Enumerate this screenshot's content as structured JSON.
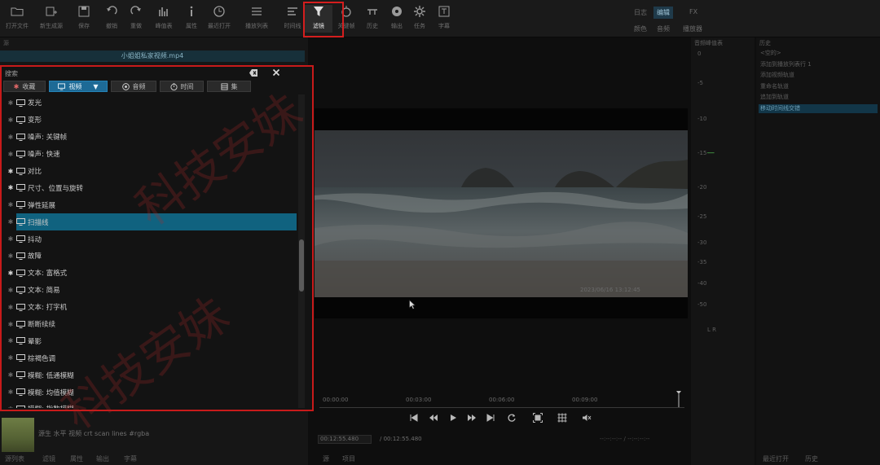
{
  "toolbar": {
    "buttons": [
      {
        "label": "打开文件",
        "icon": "folder-open-icon"
      },
      {
        "label": "新生成源",
        "icon": "new-source-icon"
      },
      {
        "label": "保存",
        "icon": "save-icon"
      },
      {
        "label": "撤销",
        "icon": "undo-icon"
      },
      {
        "label": "重做",
        "icon": "redo-icon"
      },
      {
        "label": "峰值表",
        "icon": "peak-meter-icon"
      },
      {
        "label": "属性",
        "icon": "info-icon"
      },
      {
        "label": "最近打开",
        "icon": "clock-icon"
      },
      {
        "label": "播放列表",
        "icon": "playlist-icon"
      },
      {
        "label": "时间线",
        "icon": "timeline-icon"
      },
      {
        "label": "滤镜",
        "icon": "filter-icon"
      },
      {
        "label": "关键帧",
        "icon": "keyframe-icon"
      },
      {
        "label": "历史",
        "icon": "history-icon"
      },
      {
        "label": "输出",
        "icon": "export-icon"
      },
      {
        "label": "任务",
        "icon": "jobs-icon"
      },
      {
        "label": "字幕",
        "icon": "subtitle-icon"
      }
    ],
    "layouts_top": [
      "日志",
      "编辑",
      "FX"
    ],
    "layouts_bottom": [
      "颜色",
      "音频",
      "播放器"
    ]
  },
  "left_panel": {
    "header": "源",
    "clip_name": "小姐姐私家视频.mp4"
  },
  "filter_dialog": {
    "search_label": "搜索",
    "categories": [
      {
        "label": "收藏",
        "icon": "star-icon"
      },
      {
        "label": "视频",
        "icon": "monitor-icon"
      },
      {
        "label": "音频",
        "icon": "audio-icon"
      },
      {
        "label": "时间",
        "icon": "stopwatch-icon"
      },
      {
        "label": "集",
        "icon": "set-icon"
      }
    ],
    "items": [
      {
        "label": "发光",
        "fav": false
      },
      {
        "label": "变形",
        "fav": false
      },
      {
        "label": "噪声: 关键帧",
        "fav": false
      },
      {
        "label": "噪声: 快速",
        "fav": false
      },
      {
        "label": "对比",
        "fav": true
      },
      {
        "label": "尺寸、位置与旋转",
        "fav": true
      },
      {
        "label": "弹性延展",
        "fav": false
      },
      {
        "label": "扫描线",
        "fav": false,
        "selected": true
      },
      {
        "label": "抖动",
        "fav": false
      },
      {
        "label": "故障",
        "fav": false
      },
      {
        "label": "文本: 富格式",
        "fav": true
      },
      {
        "label": "文本: 简易",
        "fav": false
      },
      {
        "label": "文本: 打字机",
        "fav": false
      },
      {
        "label": "断断续续",
        "fav": false
      },
      {
        "label": "晕影",
        "fav": false
      },
      {
        "label": "棕褐色调",
        "fav": false
      },
      {
        "label": "模糊: 低通模糊",
        "fav": false
      },
      {
        "label": "模糊: 均值模糊",
        "fav": false
      },
      {
        "label": "模糊: 指数模糊",
        "fav": false
      }
    ],
    "description": "源生 水平 视频 crt scan lines #rgba"
  },
  "left_bottom_tabs": [
    "源列表",
    "滤镜",
    "属性",
    "输出",
    "字幕"
  ],
  "viewer": {
    "timestamp": "2023/06/16 13:12:45",
    "timecodes": [
      "00:00:00",
      "00:03:00",
      "00:06:00",
      "00:09:00"
    ],
    "current_time": "00:12:55.480",
    "total_time": "/ 00:12:55.480",
    "right_timecodes": "--:--:--:-- / --:--:--:--",
    "tabs": [
      "源",
      "项目"
    ]
  },
  "audio_meter": {
    "title": "音频峰值表",
    "scale": [
      "0",
      "-5",
      "-10",
      "-15",
      "-20",
      "-25",
      "-30",
      "-35",
      "-40",
      "-50"
    ],
    "lr": "L  R"
  },
  "history": {
    "title": "历史",
    "items": [
      {
        "label": "<空的>",
        "selected": false
      },
      {
        "label": "添加到播放列表行 1",
        "selected": false
      },
      {
        "label": "添加视频轨道",
        "selected": false
      },
      {
        "label": "重命名轨道",
        "selected": false
      },
      {
        "label": "追加到轨道",
        "selected": false
      },
      {
        "label": "移动时间线交错",
        "selected": true
      }
    ],
    "tabs": [
      "最近打开",
      "历史"
    ]
  },
  "watermark": "科技安妹"
}
